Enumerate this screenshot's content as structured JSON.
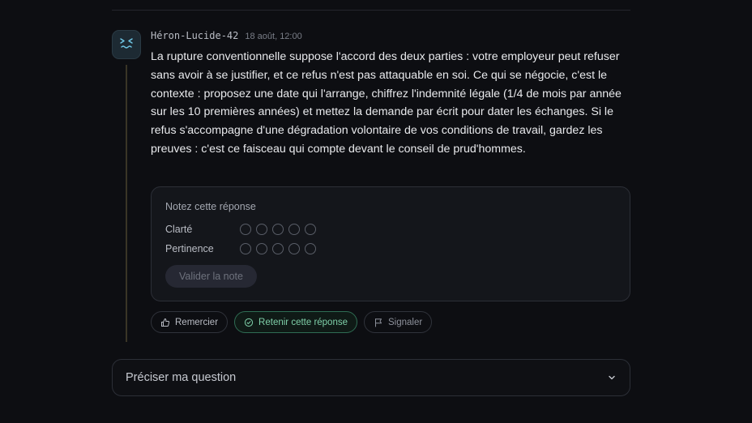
{
  "message": {
    "author": "Héron-Lucide-42",
    "timestamp": "18 août, 12:00",
    "avatar_icon": "sleepy-face-icon",
    "paragraph": "La rupture conventionnelle suppose l'accord des deux parties : votre employeur peut refuser sans avoir à se justifier, et ce refus n'est pas attaquable en soi. Ce qui se négocie, c'est le contexte : proposez une date qui l'arrange, chiffrez l'indemnité légale (1/4 de mois par année sur les 10 premières années) et mettez la demande par écrit pour dater les échanges. Si le refus s'accompagne d'une dégradation volontaire de vos conditions de travail, gardez les preuves : c'est ce faisceau qui compte devant le conseil de prud'hommes."
  },
  "rating": {
    "title": "Notez cette réponse",
    "criteria": [
      {
        "label": "Clarté",
        "max": 5,
        "value": 0
      },
      {
        "label": "Pertinence",
        "max": 5,
        "value": 0
      }
    ],
    "submit_label": "Valider la note"
  },
  "actions": {
    "thank_label": "Remercier",
    "thank_icon": "thumbs-up-icon",
    "keep_label": "Retenir cette réponse",
    "keep_icon": "check-circle-icon",
    "report_label": "Signaler",
    "report_icon": "flag-icon"
  },
  "composer": {
    "label": "Préciser ma question",
    "icon": "chevron-down-icon"
  },
  "colors": {
    "background": "#0d0e12",
    "accent_green": "#7fd0a9",
    "thread_line": "#3a3526"
  }
}
